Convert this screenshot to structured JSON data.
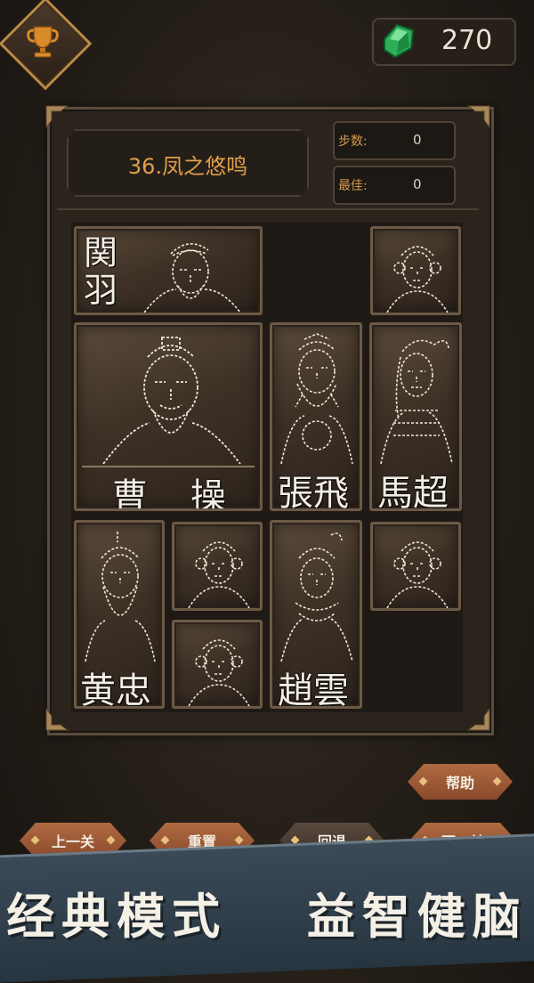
{
  "header": {
    "gems": "270",
    "trophy_icon": "trophy-icon",
    "gem_icon": "green-gem-icon"
  },
  "level": {
    "title": "36.凤之悠鸣",
    "steps_label": "步数:",
    "steps_value": "0",
    "best_label": "最佳:",
    "best_value": "0"
  },
  "tiles": {
    "guanyu": "関羽",
    "caocao_1": "曹",
    "caocao_2": "操",
    "zhangfei": "張飛",
    "machao": "馬超",
    "huangzhong": "黄忠",
    "zhaoyun": "趙雲"
  },
  "controls": {
    "help": "帮助",
    "prev": "上一关",
    "reset": "重置",
    "undo": "回退",
    "next": "下一关"
  },
  "banner": {
    "left": "经典模式",
    "right": "益智健脑"
  },
  "colors": {
    "accent_orange": "#e09f4b",
    "button": "#a05e3a",
    "gem": "#2fae5a"
  }
}
